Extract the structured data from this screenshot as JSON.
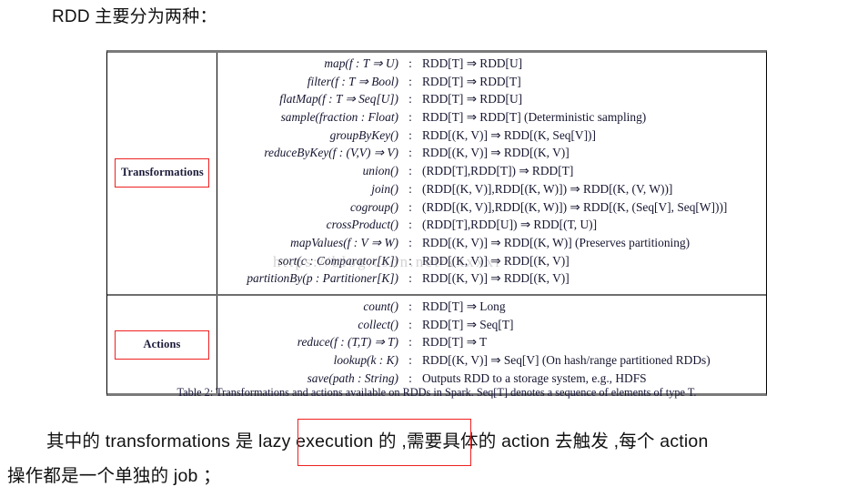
{
  "top_heading": "RDD 主要分为两种：",
  "table": {
    "sections": [
      {
        "label": "Transformations",
        "rows": [
          {
            "signature": "map(f : T ⇒ U)",
            "colon": ":",
            "type": "RDD[T] ⇒ RDD[U]"
          },
          {
            "signature": "filter(f : T ⇒ Bool)",
            "colon": ":",
            "type": "RDD[T] ⇒ RDD[T]"
          },
          {
            "signature": "flatMap(f : T ⇒ Seq[U])",
            "colon": ":",
            "type": "RDD[T] ⇒ RDD[U]"
          },
          {
            "signature": "sample(fraction : Float)",
            "colon": ":",
            "type": "RDD[T] ⇒ RDD[T]  (Deterministic sampling)"
          },
          {
            "signature": "groupByKey()",
            "colon": ":",
            "type": "RDD[(K, V)] ⇒ RDD[(K, Seq[V])]"
          },
          {
            "signature": "reduceByKey(f : (V,V) ⇒ V)",
            "colon": ":",
            "type": "RDD[(K, V)] ⇒ RDD[(K, V)]"
          },
          {
            "signature": "union()",
            "colon": ":",
            "type": "(RDD[T],RDD[T]) ⇒ RDD[T]"
          },
          {
            "signature": "join()",
            "colon": ":",
            "type": "(RDD[(K, V)],RDD[(K, W)]) ⇒ RDD[(K, (V, W))]"
          },
          {
            "signature": "cogroup()",
            "colon": ":",
            "type": "(RDD[(K, V)],RDD[(K, W)]) ⇒ RDD[(K, (Seq[V], Seq[W]))]"
          },
          {
            "signature": "crossProduct()",
            "colon": ":",
            "type": "(RDD[T],RDD[U]) ⇒ RDD[(T, U)]"
          },
          {
            "signature": "mapValues(f : V ⇒ W)",
            "colon": ":",
            "type": "RDD[(K, V)] ⇒ RDD[(K, W)]  (Preserves partitioning)"
          },
          {
            "signature": "sort(c : Comparator[K])",
            "colon": ":",
            "type": "RDD[(K, V)] ⇒ RDD[(K, V)]"
          },
          {
            "signature": "partitionBy(p : Partitioner[K])",
            "colon": ":",
            "type": "RDD[(K, V)] ⇒ RDD[(K, V)]"
          }
        ]
      },
      {
        "label": "Actions",
        "rows": [
          {
            "signature": "count()",
            "colon": ":",
            "type": "RDD[T] ⇒ Long"
          },
          {
            "signature": "collect()",
            "colon": ":",
            "type": "RDD[T] ⇒ Seq[T]"
          },
          {
            "signature": "reduce(f : (T,T) ⇒ T)",
            "colon": ":",
            "type": "RDD[T] ⇒ T"
          },
          {
            "signature": "lookup(k : K)",
            "colon": ":",
            "type": "RDD[(K, V)] ⇒ Seq[V]  (On hash/range partitioned RDDs)"
          },
          {
            "signature": "save(path : String)",
            "colon": ":",
            "type": "Outputs RDD to a storage system, e.g., HDFS"
          }
        ]
      }
    ],
    "caption": "Table 2: Transformations and actions available on RDDs in Spark. Seq[T] denotes a sequence of elements of type T."
  },
  "watermark": "https://blog.csdn.net/xxxxxr",
  "bottom_paragraph": {
    "line1": "其中的 transformations 是 lazy execution 的 ,需要具体的 action 去触发 ,每个 action",
    "line2": "操作都是一个单独的 job ；"
  },
  "colors": {
    "red_box": "#ef2020",
    "table_rule": "#7a7a7a",
    "text": "#111111",
    "table_text": "#151530"
  }
}
